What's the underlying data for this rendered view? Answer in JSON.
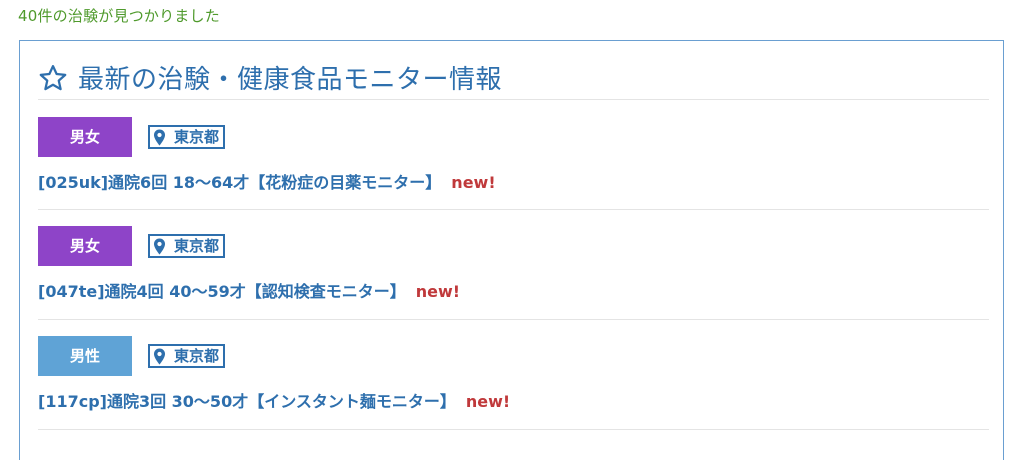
{
  "result_count": "40件の治験が見つかりました",
  "panel": {
    "title": "最新の治験・健康食品モニター情報",
    "icon": "star-outline-icon"
  },
  "entries": [
    {
      "gender": "男女",
      "gender_color": "#8e44c8",
      "location": "東京都",
      "title": "[025uk]通院6回 18〜64才【花粉症の目薬モニター】",
      "new_label": "new!"
    },
    {
      "gender": "男女",
      "gender_color": "#8e44c8",
      "location": "東京都",
      "title": "[047te]通院4回 40〜59才【認知検査モニター】",
      "new_label": "new!"
    },
    {
      "gender": "男性",
      "gender_color": "#5fa3d6",
      "location": "東京都",
      "title": "[117cp]通院3回 30〜50才【インスタント麺モニター】",
      "new_label": "new!"
    }
  ],
  "colors": {
    "accent": "#2e6fad",
    "count_text": "#4f9a2c",
    "new": "#c0393b"
  }
}
